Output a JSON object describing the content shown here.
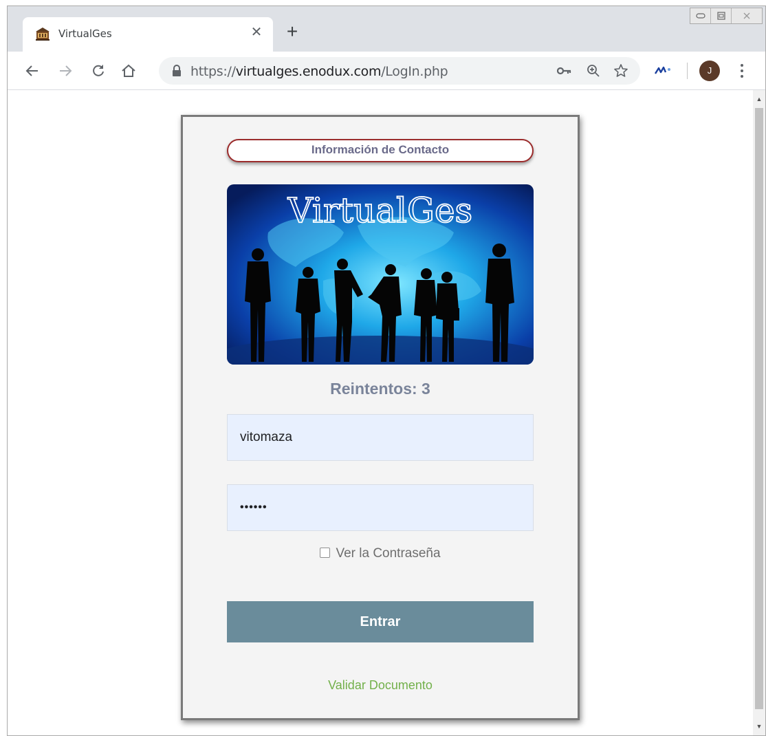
{
  "browser": {
    "tab": {
      "title": "VirtualGes",
      "favicon": "bank-building-icon",
      "close_icon": "close-icon"
    },
    "new_tab_icon": "plus-icon",
    "window_controls": [
      "minimize-icon",
      "restore-icon",
      "close-icon"
    ],
    "toolbar": {
      "back_icon": "arrow-left-icon",
      "forward_icon": "arrow-right-icon",
      "reload_icon": "reload-icon",
      "home_icon": "home-icon",
      "url": {
        "scheme": "https://",
        "host": "virtualges.enodux.com",
        "path": "/LogIn.php"
      },
      "lock_icon": "lock-icon",
      "key_icon": "key-icon",
      "zoom_icon": "zoom-icon",
      "star_icon": "star-icon",
      "extension_icon": "extension-icon",
      "avatar_initial": "J",
      "menu_icon": "vertical-dots-icon"
    }
  },
  "login": {
    "contact_button": "Información de Contacto",
    "banner_title": "VirtualGes",
    "retries_label": "Reintentos: 3",
    "username_value": "vitomaza",
    "password_value": "••••••",
    "show_password_label": "Ver la Contraseña",
    "show_password_checked": false,
    "enter_button": "Entrar",
    "validate_link": "Validar Documento"
  },
  "colors": {
    "card_background": "#f4f4f4",
    "contact_border": "#9b2b2b",
    "enter_button": "#6a8c9b",
    "validate_link": "#72b04a",
    "input_background": "#e8f0fe",
    "retries_text": "#7a849a"
  }
}
